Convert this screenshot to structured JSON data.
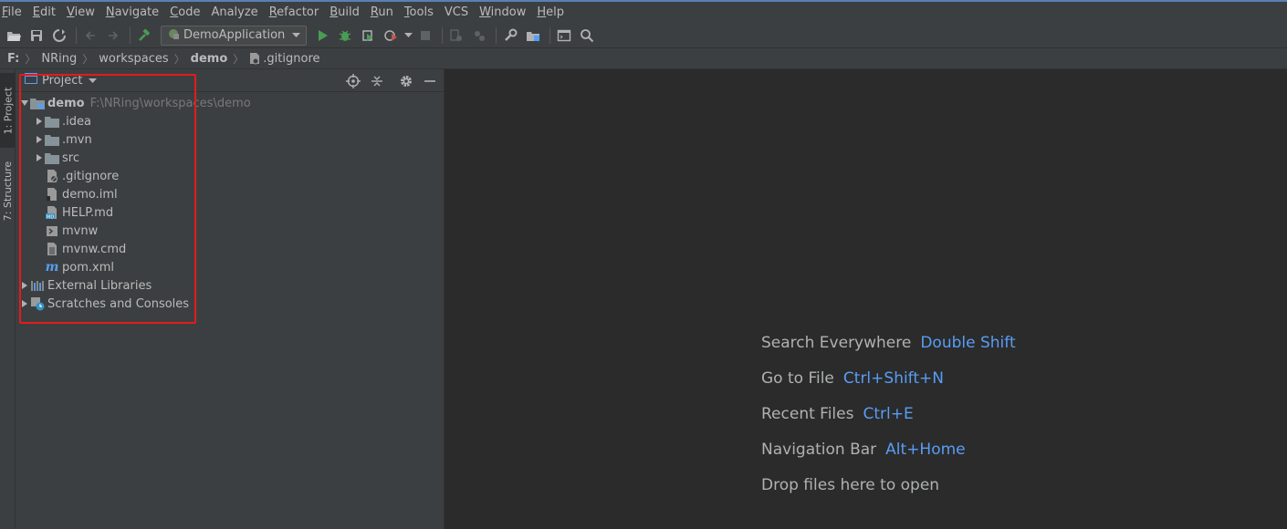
{
  "menubar": {
    "items": [
      {
        "label": "File",
        "ul": "F",
        "rest": "ile"
      },
      {
        "label": "Edit",
        "ul": "E",
        "rest": "dit"
      },
      {
        "label": "View",
        "ul": "V",
        "rest": "iew"
      },
      {
        "label": "Navigate",
        "ul": "N",
        "rest": "avigate"
      },
      {
        "label": "Code",
        "ul": "C",
        "rest": "ode"
      },
      {
        "label": "Analyze",
        "ul": "",
        "rest": "Analyze"
      },
      {
        "label": "Refactor",
        "ul": "R",
        "rest": "efactor"
      },
      {
        "label": "Build",
        "ul": "B",
        "rest": "uild"
      },
      {
        "label": "Run",
        "ul": "R",
        "rest": "un",
        "pre": ""
      },
      {
        "label": "Tools",
        "ul": "T",
        "rest": "ools"
      },
      {
        "label": "VCS",
        "ul": "",
        "rest": "VCS"
      },
      {
        "label": "Window",
        "ul": "W",
        "rest": "indow"
      },
      {
        "label": "Help",
        "ul": "H",
        "rest": "elp"
      }
    ]
  },
  "toolbar": {
    "run_config": "DemoApplication"
  },
  "breadcrumb": {
    "items": [
      "F:",
      "NRing",
      "workspaces",
      "demo",
      ".gitignore"
    ]
  },
  "sidebar": {
    "project_tab": "1: Project",
    "structure_tab": "7: Structure"
  },
  "project_panel": {
    "title": "Project",
    "root": {
      "name": "demo",
      "path": "F:\\NRing\\workspaces\\demo"
    },
    "children": [
      {
        "name": ".idea",
        "type": "folder"
      },
      {
        "name": ".mvn",
        "type": "folder"
      },
      {
        "name": "src",
        "type": "folder"
      },
      {
        "name": ".gitignore",
        "type": "gitignore"
      },
      {
        "name": "demo.iml",
        "type": "iml"
      },
      {
        "name": "HELP.md",
        "type": "md"
      },
      {
        "name": "mvnw",
        "type": "shell"
      },
      {
        "name": "mvnw.cmd",
        "type": "text"
      },
      {
        "name": "pom.xml",
        "type": "maven"
      }
    ],
    "external_libraries": "External Libraries",
    "scratches": "Scratches and Consoles"
  },
  "editor": {
    "hints": [
      {
        "label": "Search Everywhere",
        "shortcut": "Double Shift"
      },
      {
        "label": "Go to File",
        "shortcut": "Ctrl+Shift+N"
      },
      {
        "label": "Recent Files",
        "shortcut": "Ctrl+E"
      },
      {
        "label": "Navigation Bar",
        "shortcut": "Alt+Home"
      },
      {
        "label": "Drop files here to open",
        "shortcut": ""
      }
    ]
  },
  "colors": {
    "background": "#2b2b2b",
    "panel": "#3c3f41",
    "shortcut": "#589df6",
    "highlight_box": "#e31b1b",
    "run_green": "#499c54"
  }
}
